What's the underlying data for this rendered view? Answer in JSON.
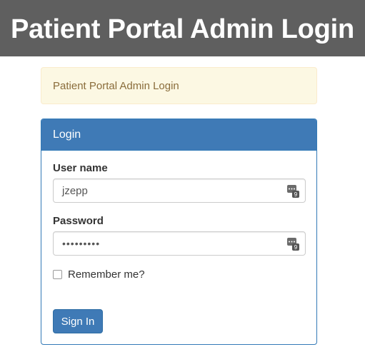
{
  "header": {
    "title": "Patient Portal Admin Login"
  },
  "notice": {
    "text": "Patient Portal Admin Login"
  },
  "login_panel": {
    "heading": "Login",
    "username": {
      "label": "User name",
      "value": "jzepp",
      "icon": "keyboard-icon"
    },
    "password": {
      "label": "Password",
      "value": "•••••••••",
      "icon": "keyboard-icon"
    },
    "remember": {
      "label": "Remember me?",
      "checked": false
    },
    "submit_label": "Sign In"
  },
  "colors": {
    "banner": "#5f5f5f",
    "primary": "#3f7ab6",
    "notice_bg": "#fcf8e3",
    "notice_text": "#8a6d3b"
  }
}
